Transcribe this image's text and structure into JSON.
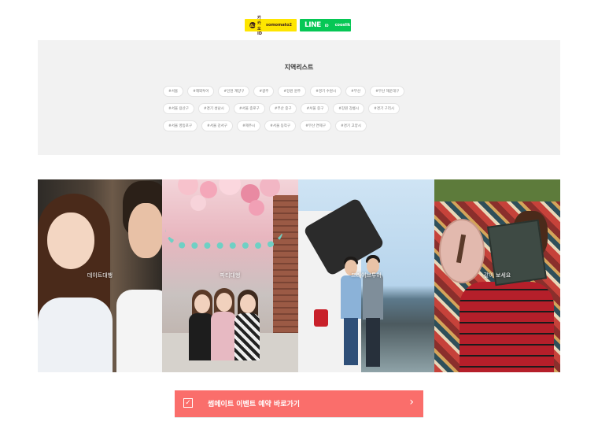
{
  "contacts": {
    "kakao": {
      "service": "카카오ID",
      "id": "somomato2",
      "icon": "kakao-talk-icon",
      "color": "#fee500"
    },
    "line": {
      "logo": "LINE",
      "service": "ID",
      "id": "cooslik",
      "color": "#06c755"
    }
  },
  "region": {
    "title": "지역리스트",
    "tags": [
      "#서울",
      "#해외투어",
      "#인천 계양구",
      "#광주",
      "#강원 원주",
      "#경기 수원시",
      "#부산",
      "#부산 해운대구",
      "#서울 용산구",
      "#경기 성남시",
      "#서울 종로구",
      "#부산 중구",
      "#서울 중구",
      "#강원 강릉시",
      "#경기 구리시",
      "#서울 영등포구",
      "#서울 강서구",
      "#제주시",
      "#서울 동작구",
      "#부산 연제구",
      "#경기 고양시"
    ]
  },
  "gallery": [
    {
      "caption": "데이트대행",
      "scene": "couple"
    },
    {
      "caption": "파티대행",
      "scene": "party"
    },
    {
      "caption": "드라이브투어",
      "scene": "drive"
    },
    {
      "caption": "같이 보세요",
      "scene": "reading"
    }
  ],
  "cta": {
    "label": "썸메이트 이벤트 예약 바로가기",
    "icon": "checkbox-icon",
    "arrow": "chevron-right-icon",
    "color": "#fa6e6b"
  }
}
